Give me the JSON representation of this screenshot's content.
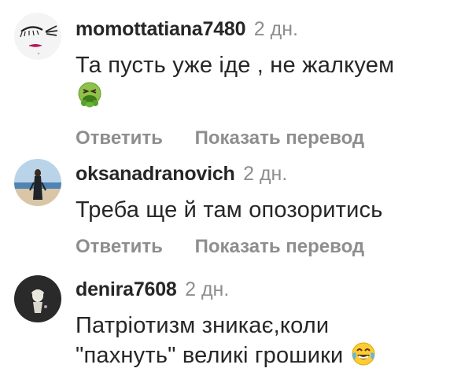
{
  "comments": [
    {
      "username": "momottatiana7480",
      "time": "2 дн.",
      "text": "Та пусть уже іде , не жалкуем",
      "emoji": "nauseated-face-emoji",
      "actions": {
        "reply": "Ответить",
        "translate": "Показать перевод"
      }
    },
    {
      "username": "oksanadranovich",
      "time": "2 дн.",
      "text": "Треба ще й там опозоритись",
      "actions": {
        "reply": "Ответить",
        "translate": "Показать перевод"
      }
    },
    {
      "username": "denira7608",
      "time": "2 дн.",
      "text_line1": "Патріотизм зникає,коли",
      "text_line2": "\"пахнуть\" великі грошики",
      "emoji": "tears-of-joy-emoji"
    }
  ]
}
